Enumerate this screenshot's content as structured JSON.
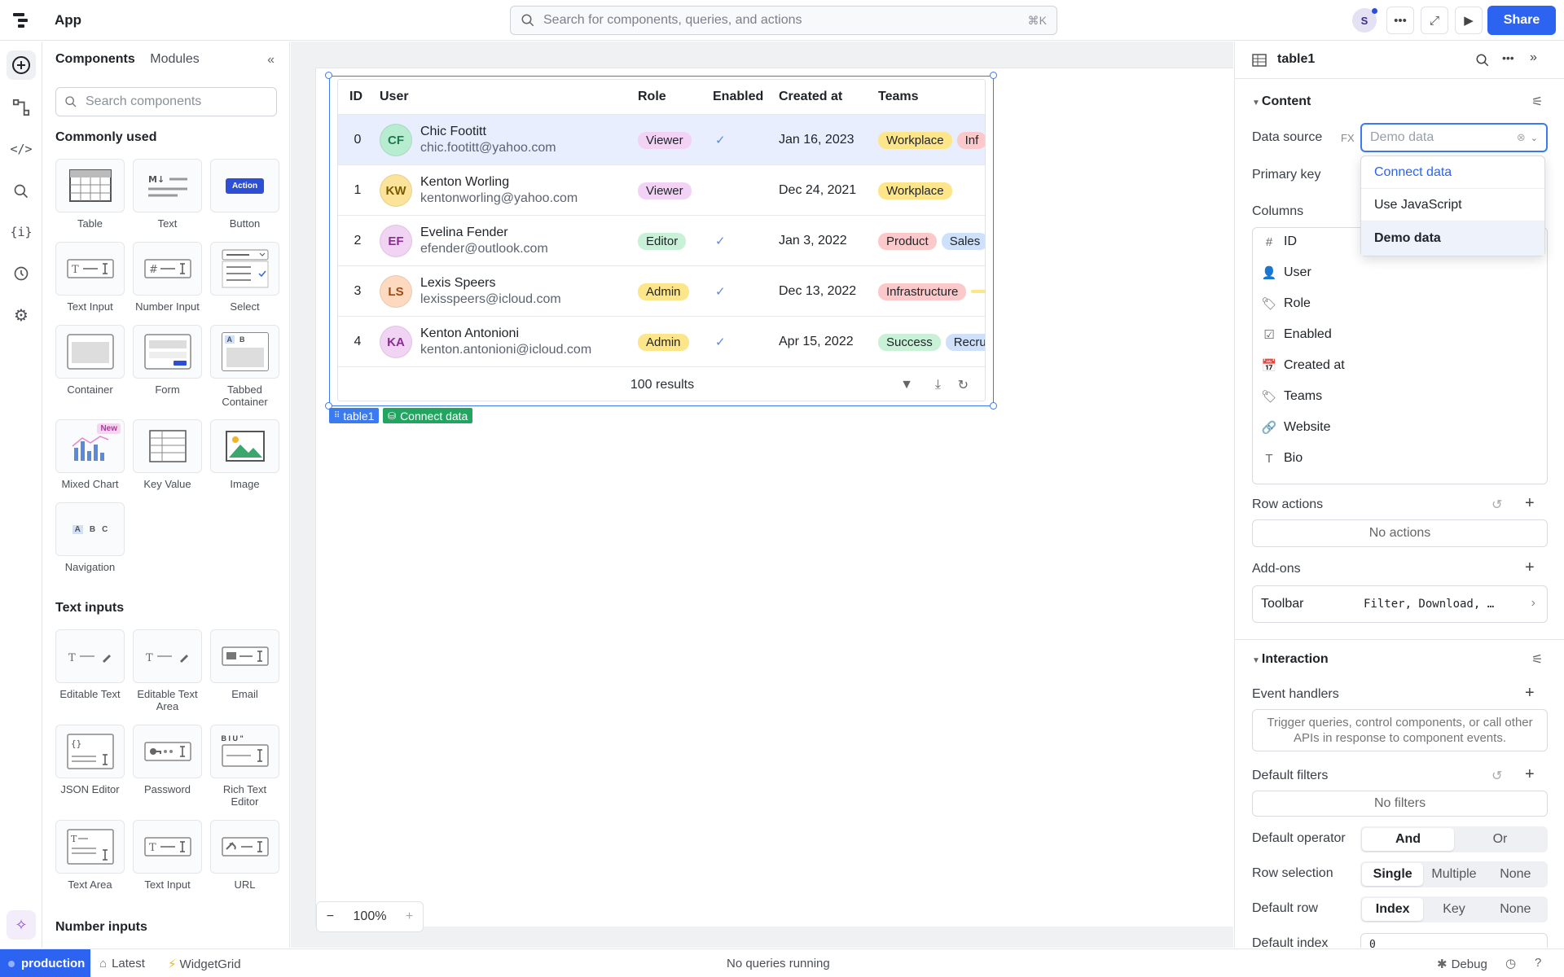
{
  "app": {
    "title": "App",
    "search_placeholder": "Search for components, queries, and actions",
    "search_shortcut": "⌘K",
    "user_initial": "S",
    "share_label": "Share"
  },
  "left_panel": {
    "tabs": [
      "Components",
      "Modules"
    ],
    "search_placeholder": "Search components",
    "sections": [
      {
        "title": "Commonly used",
        "items": [
          "Table",
          "Text",
          "Button",
          "Text Input",
          "Number Input",
          "Select",
          "Container",
          "Form",
          "Tabbed Container",
          "Mixed Chart",
          "Key Value",
          "Image",
          "Navigation"
        ]
      },
      {
        "title": "Text inputs",
        "items": [
          "Editable Text",
          "Editable Text Area",
          "Email",
          "JSON Editor",
          "Password",
          "Rich Text Editor",
          "Text Area",
          "Text Input",
          "URL"
        ]
      },
      {
        "title": "Number inputs",
        "items": []
      }
    ],
    "button_preview_label": "Action",
    "new_badge": "New",
    "tabbed_preview": [
      "A",
      "B"
    ],
    "nav_preview": [
      "A",
      "B",
      "C"
    ],
    "rte_preview": "B I U \""
  },
  "table": {
    "columns": [
      "ID",
      "User",
      "Role",
      "Enabled",
      "Created at",
      "Teams"
    ],
    "rows": [
      {
        "id": "0",
        "initials": "CF",
        "name": "Chic Footitt",
        "email": "chic.footitt@yahoo.com",
        "role": "Viewer",
        "enabled": true,
        "created": "Jan 16, 2023",
        "teams": [
          "Workplace",
          "Inf"
        ],
        "avatar_color": "#b8ecd0",
        "avatar_text": "#1e7a4c"
      },
      {
        "id": "1",
        "initials": "KW",
        "name": "Kenton Worling",
        "email": "kentonworling@yahoo.com",
        "role": "Viewer",
        "enabled": false,
        "created": "Dec 24, 2021",
        "teams": [
          "Workplace"
        ],
        "avatar_color": "#fbe39a",
        "avatar_text": "#7a5a00"
      },
      {
        "id": "2",
        "initials": "EF",
        "name": "Evelina Fender",
        "email": "efender@outlook.com",
        "role": "Editor",
        "enabled": true,
        "created": "Jan 3, 2022",
        "teams": [
          "Product",
          "Sales"
        ],
        "avatar_color": "#f1d4f3",
        "avatar_text": "#8a2c93"
      },
      {
        "id": "3",
        "initials": "LS",
        "name": "Lexis Speers",
        "email": "lexisspeers@icloud.com",
        "role": "Admin",
        "enabled": true,
        "created": "Dec 13, 2022",
        "teams": [
          "Infrastructure",
          ""
        ],
        "avatar_color": "#fdd9bf",
        "avatar_text": "#9a4a12"
      },
      {
        "id": "4",
        "initials": "KA",
        "name": "Kenton Antonioni",
        "email": "kenton.antonioni@icloud.com",
        "role": "Admin",
        "enabled": true,
        "created": "Apr 15, 2022",
        "teams": [
          "Success",
          "Recru"
        ],
        "avatar_color": "#f1d4f3",
        "avatar_text": "#8a2c93"
      }
    ],
    "footer": "100 results",
    "name_tag": "table1",
    "connect_tag": "Connect data",
    "enabled_check": "✓"
  },
  "colors": {
    "Viewer": "#f2d3f5",
    "Editor": "#c9f1d8",
    "Admin": "#fde58a",
    "Workplace": "#fde58a",
    "Inf": "#fbc9c9",
    "Product": "#fbc9c9",
    "Sales": "#cfe0fb",
    "Infrastructure": "#fbc9c9",
    "Success": "#c9f1d8",
    "Recru": "#cfe0fb",
    "": "#fde58a"
  },
  "zoom": {
    "minus": "−",
    "level": "100%",
    "plus": "+"
  },
  "inspector": {
    "component": "table1",
    "content_title": "Content",
    "data_source_label": "Data source",
    "fx": "FX",
    "data_source_value": "Demo data",
    "dropdown": [
      "Connect data",
      "Use JavaScript",
      "Demo data"
    ],
    "primary_key_label": "Primary key",
    "columns_label": "Columns",
    "columns": [
      {
        "icon": "#",
        "name": "ID"
      },
      {
        "icon": "👤",
        "name": "User"
      },
      {
        "icon": "🏷",
        "name": "Role"
      },
      {
        "icon": "☑",
        "name": "Enabled"
      },
      {
        "icon": "📅",
        "name": "Created at"
      },
      {
        "icon": "🏷",
        "name": "Teams"
      },
      {
        "icon": "🔗",
        "name": "Website"
      },
      {
        "icon": "T",
        "name": "Bio"
      }
    ],
    "row_actions_label": "Row actions",
    "no_actions": "No actions",
    "addons_label": "Add-ons",
    "toolbar_label": "Toolbar",
    "toolbar_value": "Filter, Download, …",
    "interaction_title": "Interaction",
    "event_handlers_label": "Event handlers",
    "event_handlers_hint": "Trigger queries, control components, or call other APIs in response to component events.",
    "default_filters_label": "Default filters",
    "no_filters": "No filters",
    "default_operator_label": "Default operator",
    "operator_options": [
      "And",
      "Or"
    ],
    "row_selection_label": "Row selection",
    "selection_options": [
      "Single",
      "Multiple",
      "None"
    ],
    "default_row_label": "Default row",
    "default_row_options": [
      "Index",
      "Key",
      "None"
    ],
    "default_index_label": "Default index",
    "default_index_value": "0"
  },
  "status": {
    "env": "production",
    "branch": "Latest",
    "plugin": "WidgetGrid",
    "queries": "No queries running",
    "debug": "Debug"
  }
}
